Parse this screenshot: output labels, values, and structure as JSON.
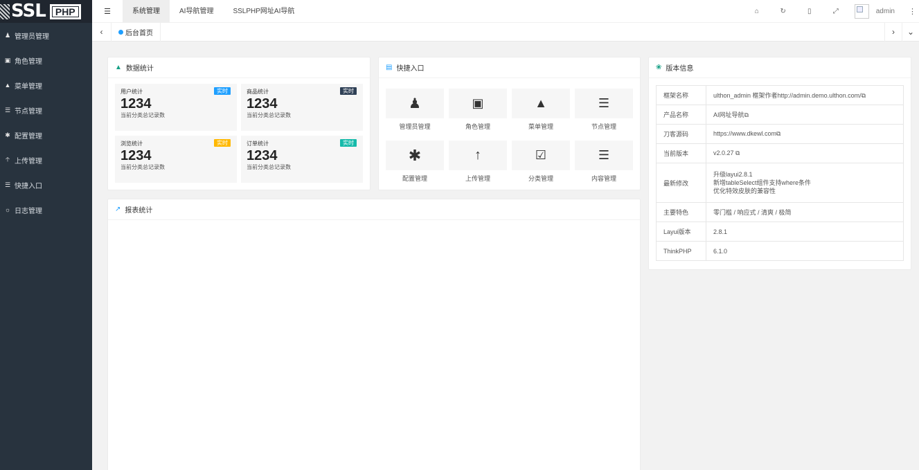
{
  "sidebar": {
    "logo_text": "SSL",
    "logo_badge": "PHP",
    "items": [
      {
        "label": "管理员管理",
        "icon": "user-icon"
      },
      {
        "label": "角色管理",
        "icon": "role-icon"
      },
      {
        "label": "菜单管理",
        "icon": "tree-icon"
      },
      {
        "label": "节点管理",
        "icon": "list-icon"
      },
      {
        "label": "配置管理",
        "icon": "asterisk-icon"
      },
      {
        "label": "上传管理",
        "icon": "upload-icon"
      },
      {
        "label": "快捷入口",
        "icon": "list-icon"
      },
      {
        "label": "日志管理",
        "icon": "log-icon"
      }
    ]
  },
  "header": {
    "tabs": [
      "系统管理",
      "AI导航管理",
      "SSLPHP网址AI导航"
    ],
    "active_tab": 0,
    "user": "admin",
    "icons": [
      "home-icon",
      "refresh-icon",
      "clear-icon",
      "fullscreen-icon"
    ]
  },
  "tabsbar": {
    "tab": "后台首页"
  },
  "data_stats": {
    "title": "数据统计",
    "items": [
      {
        "name": "用户统计",
        "value": "1234",
        "desc": "当前分类总记录数",
        "badge": "实时",
        "badge_color": "#1e9fff"
      },
      {
        "name": "商品统计",
        "value": "1234",
        "desc": "当前分类总记录数",
        "badge": "实时",
        "badge_color": "#2f4056"
      },
      {
        "name": "浏览统计",
        "value": "1234",
        "desc": "当前分类总记录数",
        "badge": "实时",
        "badge_color": "#ffb800"
      },
      {
        "name": "订单统计",
        "value": "1234",
        "desc": "当前分类总记录数",
        "badge": "实时",
        "badge_color": "#16baaa"
      }
    ]
  },
  "quick_entry": {
    "title": "快捷入口",
    "items": [
      {
        "label": "管理员管理",
        "icon": "user-icon"
      },
      {
        "label": "角色管理",
        "icon": "role-icon"
      },
      {
        "label": "菜单管理",
        "icon": "tree-icon"
      },
      {
        "label": "节点管理",
        "icon": "list-icon"
      },
      {
        "label": "配置管理",
        "icon": "asterisk-icon"
      },
      {
        "label": "上传管理",
        "icon": "upload-icon"
      },
      {
        "label": "分类管理",
        "icon": "calendar-check-icon"
      },
      {
        "label": "内容管理",
        "icon": "list-icon"
      }
    ]
  },
  "report": {
    "title": "报表统计"
  },
  "version": {
    "title": "版本信息",
    "rows": [
      {
        "k": "框架名称",
        "v": [
          "ulthon_admin 框架作者http://admin.demo.ulthon.com/"
        ],
        "copy": true
      },
      {
        "k": "产品名称",
        "v": [
          "AI网址导航"
        ],
        "copy": true
      },
      {
        "k": "刀客源码",
        "v": [
          "https://www.dkewl.com"
        ],
        "copy": true
      },
      {
        "k": "当前版本",
        "v": [
          "v2.0.27"
        ],
        "copy": true
      },
      {
        "k": "最新修改",
        "v": [
          "升级layui2.8.1",
          "新增tableSelect组件支持where条件",
          "优化特效皮肤的兼容性"
        ],
        "copy": false
      },
      {
        "k": "主要特色",
        "v": [
          "零门槛 / 响应式 / 清爽 / 极简"
        ],
        "copy": false
      },
      {
        "k": "Layui版本",
        "v": [
          "2.8.1"
        ],
        "copy": false
      },
      {
        "k": "ThinkPHP",
        "v": [
          "6.1.0"
        ],
        "copy": false
      }
    ]
  },
  "colors": {
    "sidebar_bg": "#28333e",
    "logo_bg": "#20262f",
    "accent_blue": "#1e9fff",
    "accent_green": "#16baaa"
  }
}
